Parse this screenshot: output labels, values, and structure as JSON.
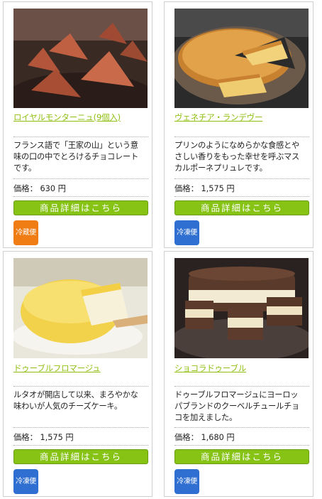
{
  "products": [
    {
      "title": "ロイヤルモンターニュ(9個入)",
      "desc_lines": [
        "フランス語で「王家の山」という意",
        "味の口の中でとろけるチョコレート",
        "です。"
      ],
      "price": "価格： 630 円",
      "button": "商品詳細はこちら",
      "badge": "冷蔵便",
      "badge_color": "#f07d14"
    },
    {
      "title": "ヴェネチア・ランデヴー",
      "desc_lines": [
        "プリンのようになめらかな食感とや",
        "さしい香りをもった幸せを呼ぶマス",
        "カルポーネプリュレです。"
      ],
      "price": "価格： 1,575 円",
      "button": "商品詳細はこちら",
      "badge": "冷凍便",
      "badge_color": "#2f6fd1"
    },
    {
      "title": "ドゥーブルフロマージュ",
      "desc_lines": [
        "ルタオが開店して以来、まろやかな",
        "味わいが人気のチーズケーキ。"
      ],
      "price": "価格： 1,575 円",
      "button": "商品詳細はこちら",
      "badge": "冷凍便",
      "badge_color": "#2f6fd1"
    },
    {
      "title": "ショコラドゥーブル",
      "desc_lines": [
        "ドゥーブルフロマージュにヨーロッ",
        "パブランドのクーベルチュールチョ",
        "コを加えました。"
      ],
      "price": "価格： 1,680 円",
      "button": "商品詳細はこちら",
      "badge": "冷凍便",
      "badge_color": "#2f6fd1"
    }
  ]
}
